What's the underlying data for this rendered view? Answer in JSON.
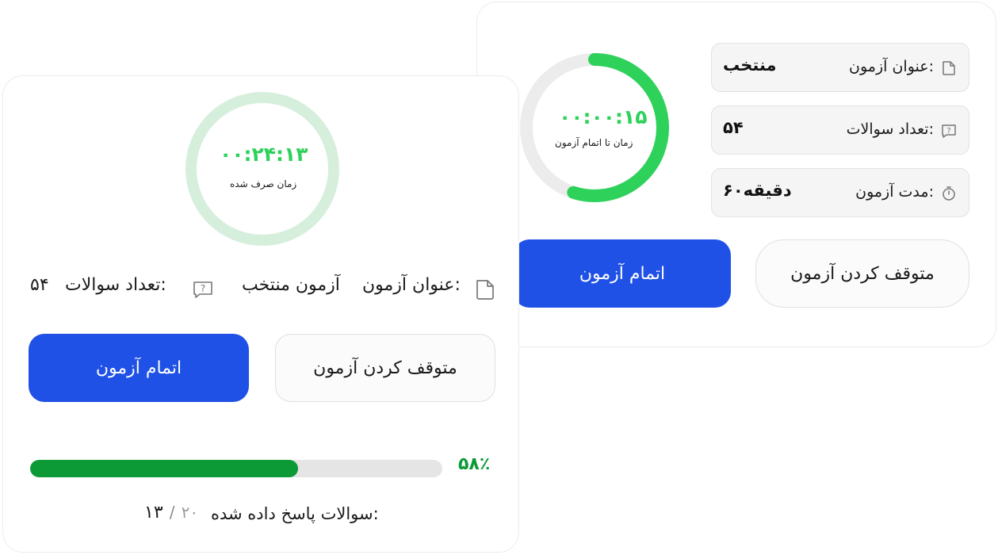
{
  "back_card": {
    "timer": {
      "time": "۰۰:۰۰:۱۵",
      "caption": "زمان تا اتمام آزمون",
      "progress": 0.55,
      "color": "#2ed15a",
      "track_color": "#ececec"
    },
    "info": [
      {
        "icon": "document-icon",
        "label": "عنوان آزمون:",
        "value": "منتخب"
      },
      {
        "icon": "question-bubble-icon",
        "label": "تعداد سوالات:",
        "value": "۵۴"
      },
      {
        "icon": "stopwatch-icon",
        "label": "مدت آزمون:",
        "value": "۶۰دقیقه"
      }
    ],
    "finish_button": "اتمام آزمون",
    "pause_button": "متوقف کردن آزمون"
  },
  "front_card": {
    "timer": {
      "time": "۰۰:۲۴:۱۳",
      "caption": "زمان صرف شده",
      "ring_color": "#d6efdc"
    },
    "title_label": "عنوان آزمون:",
    "title_value": "آزمون منتخب",
    "count_label": "تعداد سوالات:",
    "count_value": "۵۴",
    "finish_button": "اتمام آزمون",
    "pause_button": "متوقف کردن آزمون",
    "progress": {
      "percent_text": "۵۸٪",
      "value": 0.65,
      "fill_color": "#0b9a35"
    },
    "answered_label": "سوالات پاسخ داده شده:",
    "answered_total": "۲۰",
    "answered_separator": "/",
    "answered_count": "۱۳"
  },
  "colors": {
    "primary": "#1f51e6",
    "success": "#2ed15a",
    "success_dark": "#0b9a35"
  }
}
